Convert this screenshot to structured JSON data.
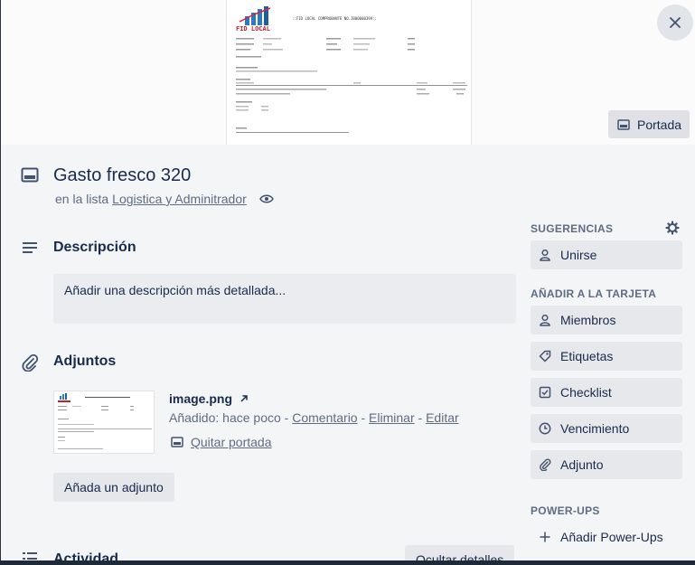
{
  "cover": {
    "button_label": "Portada",
    "document": {
      "header_line": "::FID LOCAL COMPROBANTE NO.JB00000399::",
      "logo_text": "FID LOCAL"
    }
  },
  "card": {
    "title": "Gasto fresco 320",
    "list_prefix": "en la lista",
    "list_name": "Logistica y Adminitrador"
  },
  "description": {
    "heading": "Descripción",
    "placeholder": "Añadir una descripción más detallada..."
  },
  "attachments": {
    "heading": "Adjuntos",
    "items": [
      {
        "name": "image.png",
        "added": "Añadido: hace poco",
        "actions": [
          "Comentario",
          "Eliminar",
          "Editar"
        ],
        "separator": " - ",
        "cover_action": "Quitar portada"
      }
    ],
    "add_button": "Añada un adjunto"
  },
  "activity": {
    "heading": "Actividad",
    "toggle_button": "Ocultar detalles"
  },
  "sidebar": {
    "suggestions_heading": "SUGERENCIAS",
    "suggestions": [
      {
        "label": "Unirse",
        "icon": "person-icon"
      }
    ],
    "add_heading": "AÑADIR A LA TARJETA",
    "add_items": [
      {
        "label": "Miembros",
        "icon": "person-icon"
      },
      {
        "label": "Etiquetas",
        "icon": "tag-icon"
      },
      {
        "label": "Checklist",
        "icon": "checkbox-icon"
      },
      {
        "label": "Vencimiento",
        "icon": "clock-icon"
      },
      {
        "label": "Adjunto",
        "icon": "paperclip-icon"
      }
    ],
    "powerups_heading": "POWER-UPS",
    "powerups_add": "Añadir Power-Ups"
  }
}
